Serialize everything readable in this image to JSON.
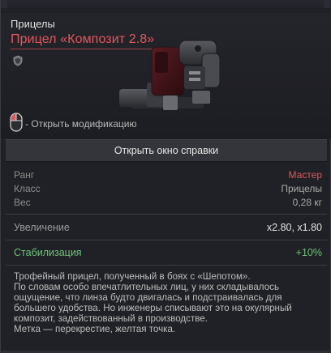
{
  "item": {
    "category": "Прицелы",
    "title": "Прицел «Композит 2.8»",
    "hint": "- Открыть модификацию",
    "help_button": "Открыть окно справки"
  },
  "stats": {
    "rank": {
      "label": "Ранг",
      "value": "Мастер"
    },
    "class": {
      "label": "Класс",
      "value": "Прицелы"
    },
    "weight": {
      "label": "Вес",
      "value": "0,28 кг"
    },
    "zoom": {
      "label": "Увеличение",
      "value": "x2.80, x1.80"
    },
    "stabilization": {
      "label": "Стабилизация",
      "value": "+10%"
    }
  },
  "description": "Трофейный прицел, полученный в боях с «Шепотом».\nПо словам особо впечатлительных лиц, у них складывалось ощущение, что линза будто двигалась и подстраивалась для большего удобства. Но инженеры списывают это на окулярный композит, задействованный в производстве.\nМетка — перекрестие, желтая точка.",
  "colors": {
    "title_red": "#e2565e",
    "rank_red": "#e2565e",
    "stat_green": "#6fc47a"
  },
  "icons": [
    "shield-icon",
    "mouse-icon",
    "scope-item-image"
  ]
}
